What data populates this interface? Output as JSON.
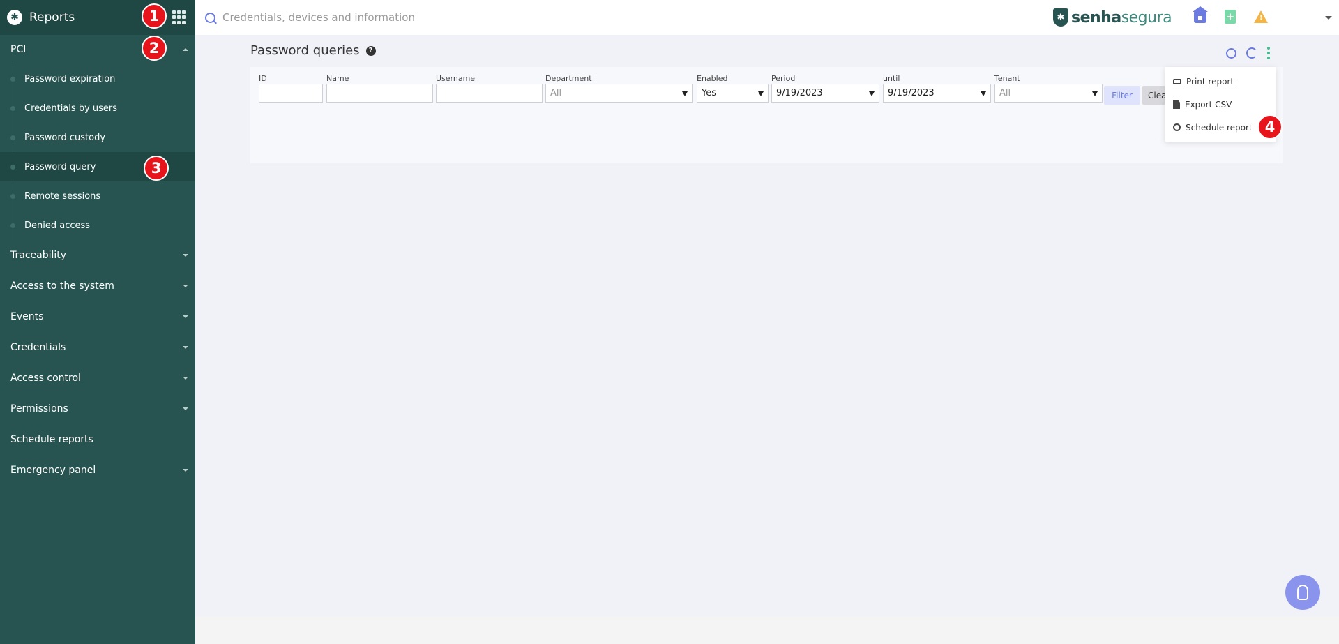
{
  "sidebar": {
    "title": "Reports",
    "section": {
      "label": "PCI"
    },
    "items": [
      {
        "label": "Password expiration"
      },
      {
        "label": "Credentials by users"
      },
      {
        "label": "Password custody"
      },
      {
        "label": "Password query"
      },
      {
        "label": "Remote sessions"
      },
      {
        "label": "Denied access"
      }
    ],
    "categories": [
      {
        "label": "Traceability"
      },
      {
        "label": "Access to the system"
      },
      {
        "label": "Events"
      },
      {
        "label": "Credentials"
      },
      {
        "label": "Access control"
      },
      {
        "label": "Permissions"
      },
      {
        "label": "Schedule reports"
      },
      {
        "label": "Emergency panel"
      }
    ]
  },
  "topbar": {
    "search_placeholder": "Credentials, devices and information",
    "brand_part1": "senha",
    "brand_part2": "segura"
  },
  "page": {
    "title": "Password queries"
  },
  "filters": {
    "id_label": "ID",
    "name_label": "Name",
    "username_label": "Username",
    "department_label": "Department",
    "department_value": "All",
    "enabled_label": "Enabled",
    "enabled_value": "Yes",
    "period_label": "Period",
    "period_value": "9/19/2023",
    "until_label": "until",
    "until_value": "9/19/2023",
    "tenant_label": "Tenant",
    "tenant_value": "All",
    "filter_button": "Filter",
    "clear_button": "Clear"
  },
  "menu": {
    "items": [
      {
        "label": "Print report"
      },
      {
        "label": "Export CSV"
      },
      {
        "label": "Schedule report"
      }
    ]
  },
  "badges": [
    "1",
    "2",
    "3",
    "4"
  ],
  "colors": {
    "sidebar_bg": "#275450",
    "accent": "#6b7be0",
    "badge": "#e8141c"
  }
}
